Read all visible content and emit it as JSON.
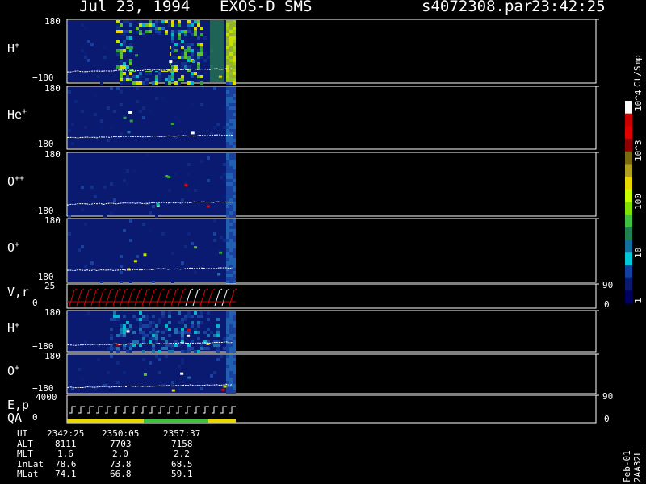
{
  "header": {
    "date": "Jul 23, 1994",
    "instrument": "EXOS-D SMS",
    "file": "s4072308.par",
    "time": "23:42:25"
  },
  "panels": [
    {
      "label": "H",
      "sup": "+",
      "ymax": "180",
      "ymin": "−180"
    },
    {
      "label": "He",
      "sup": "+",
      "ymax": "180",
      "ymin": "−180"
    },
    {
      "label": "O",
      "sup": "++",
      "ymax": "180",
      "ymin": "−180"
    },
    {
      "label": "O",
      "sup": "+",
      "ymax": "180",
      "ymin": "−180"
    },
    {
      "label": "V,r",
      "sup": "",
      "ymax": "25",
      "ymin": "0",
      "rmax": "90",
      "rmin": "0"
    },
    {
      "label": "H",
      "sup": "+",
      "ymax": "180",
      "ymin": "−180"
    },
    {
      "label": "O",
      "sup": "+",
      "ymax": "180",
      "ymin": "−180"
    },
    {
      "label": "E,p",
      "label2": "QA",
      "sup": "",
      "ymax": "4000",
      "ymin": "0",
      "rmax": "90",
      "rmin": "0"
    }
  ],
  "colorbar": {
    "units": "Ct/Smp",
    "ticks": [
      "10^4",
      "10^3",
      "100",
      "10",
      "1"
    ],
    "colors": [
      "#ffffff",
      "#c80000",
      "#e00000",
      "#900000",
      "#7a6a10",
      "#b0a020",
      "#e8d800",
      "#c8ff00",
      "#80e000",
      "#40c040",
      "#208050",
      "#1070a0",
      "#00c8d8",
      "#1040a0",
      "#0a1a70",
      "#000060"
    ]
  },
  "footer": {
    "rows": [
      {
        "name": "UT",
        "values": [
          "2342:25",
          "2350:05",
          "2357:37"
        ]
      },
      {
        "name": "ALT",
        "values": [
          "8111",
          "7703",
          "7158"
        ]
      },
      {
        "name": "MLT",
        "values": [
          "1.6",
          "2.0",
          "2.2"
        ]
      },
      {
        "name": "InLat",
        "values": [
          "78.6",
          "73.8",
          "68.5"
        ]
      },
      {
        "name": "MLat",
        "values": [
          "74.1",
          "66.8",
          "59.1"
        ]
      }
    ],
    "stamp": "Feb-01 2AA32L"
  },
  "chart_data": {
    "type": "heatmap",
    "title": "Jul 23, 1994 EXOS-D SMS",
    "x_label_rows": [
      "UT",
      "ALT",
      "MLT",
      "InLat",
      "MLat"
    ],
    "x_ticks_ut": [
      "2342:25",
      "2350:05",
      "2357:37"
    ],
    "panels": [
      "H+",
      "He+",
      "O++",
      "O+",
      "V,r",
      "H+",
      "O+",
      "E,p"
    ],
    "colorbar_units": "Ct/Smp",
    "colorbar_range": [
      1,
      10000
    ],
    "colorbar_scale": "log"
  }
}
